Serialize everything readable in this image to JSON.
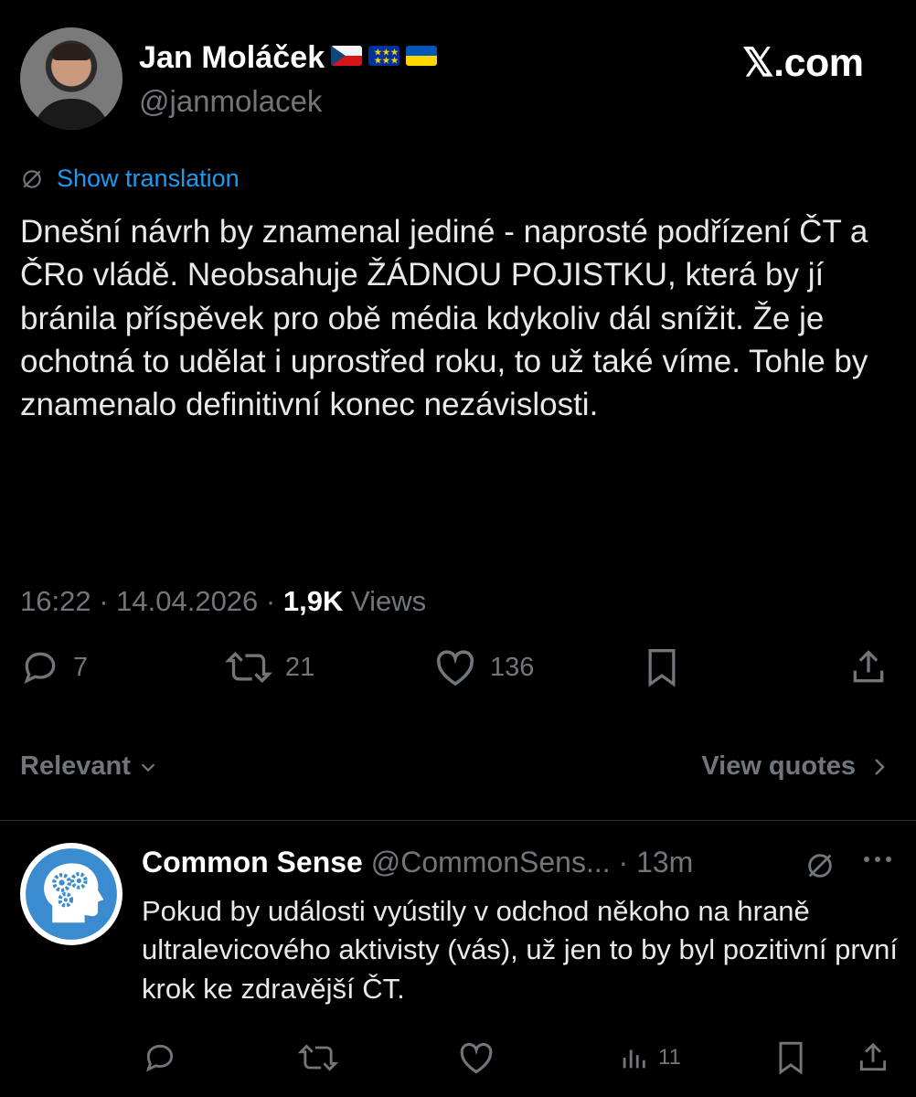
{
  "author": {
    "name": "Jan Moláček",
    "handle": "@janmolacek",
    "flags": [
      "czech-flag",
      "eu-flag",
      "ukraine-flag"
    ]
  },
  "brand": "𝕏.com",
  "show_translation": "Show translation",
  "tweet_text": "Dnešní návrh by znamenal jediné - naprosté podřízení ČT a ČRo vládě. Neobsahuje ŽÁDNOU POJISTKU, která by jí bránila příspěvek pro obě média kdykoliv dál snížit. Že je ochotná to udělat i uprostřed roku, to už také víme. Tohle by znamenalo definitivní konec nezávislosti.",
  "meta": {
    "time": "16:22",
    "date": "14.04.2026",
    "views_count": "1,9K",
    "views_label": "Views",
    "separator": " · "
  },
  "actions": {
    "replies": "7",
    "reposts": "21",
    "likes": "136"
  },
  "sort_label": "Relevant",
  "view_quotes": "View quotes",
  "reply": {
    "name": "Common Sense",
    "handle": "@CommonSens...",
    "time": "· 13m",
    "text": "Pokud by události vyústily v odchod někoho na hraně ultralevicového aktivisty (vás), už jen to by byl pozitivní první krok ke zdravější ČT.",
    "views": "11"
  },
  "colors": {
    "background": "#000000",
    "text": "#e7e9ea",
    "muted": "#71767b",
    "link": "#1d9bf0",
    "avatar_brand": "#3b8bd0"
  }
}
